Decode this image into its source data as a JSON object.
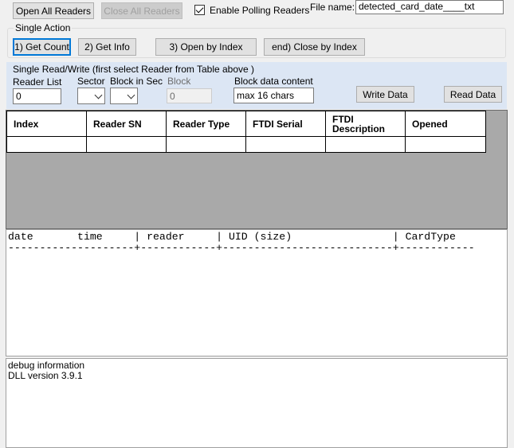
{
  "top": {
    "open_all": "Open All Readers",
    "close_all": "Close All Readers",
    "polling_label": "Enable Polling Readers",
    "polling_checked": true,
    "file_name_label": "File name:",
    "file_name_value": "detected_card_date____txt"
  },
  "single_action": {
    "title": "Single Action",
    "get_count": "1) Get Count",
    "get_info": "2) Get Info",
    "open_by_index": "3) Open by Index",
    "close_by_index": "end) Close by Index"
  },
  "read_write": {
    "title": "Single Read/Write  (first select Reader from Table above )",
    "reader_list_label": "Reader List",
    "reader_list_value": "0",
    "sector_label": "Sector",
    "block_in_sec_label": "Block in Sec",
    "block_label": "Block",
    "block_value": "0",
    "block_data_label": "Block data content",
    "block_data_placeholder": "max 16 chars",
    "write_data": "Write Data",
    "read_data": "Read Data"
  },
  "readers_table": {
    "columns": [
      "Index",
      "Reader SN",
      "Reader Type",
      "FTDI Serial",
      "FTDI Description",
      "Opened"
    ],
    "rows": [
      [
        "",
        "",
        "",
        "",
        "",
        ""
      ]
    ]
  },
  "log": {
    "header": "date       time     | reader     | UID (size)                | CardType",
    "separator": "--------------------+------------+---------------------------+------------"
  },
  "debug": {
    "text": "debug information\nDLL version 3.9.1"
  }
}
